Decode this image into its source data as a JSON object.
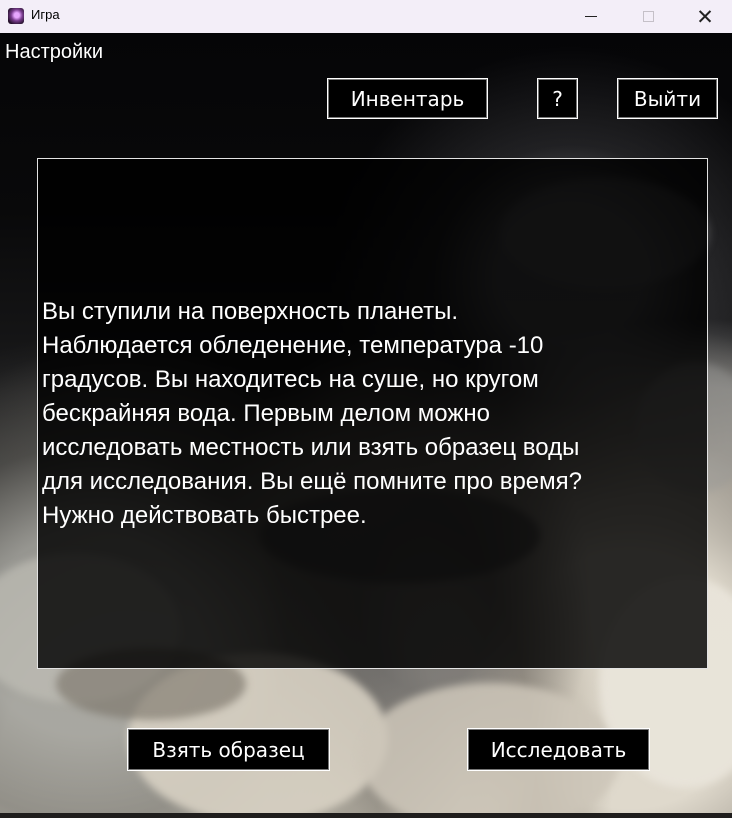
{
  "window": {
    "title": "Игра",
    "controls": {
      "minimize": "—",
      "maximize": "□",
      "close": "✕"
    },
    "app_icon": "galaxy-icon"
  },
  "game": {
    "menu": {
      "settings": "Настройки"
    },
    "top_buttons": {
      "inventory": "Инвентарь",
      "help": "?",
      "exit": "Выйти"
    },
    "story_text": "Вы ступили на поверхность планеты.\nНаблюдается обледенение, температура -10\nградусов. Вы находитесь на суше, но кругом\nбескрайняя вода. Первым делом можно\nисследовать местность или взять образец воды\nдля исследования. Вы ещё помните про время?\nНужно действовать быстрее.",
    "actions": {
      "take_sample": "Взять образец",
      "explore": "Исследовать"
    }
  },
  "colors": {
    "text": "#ffffff",
    "button_background": "#000000",
    "border": "#ffffff",
    "titlebar": "#f3eef8"
  }
}
